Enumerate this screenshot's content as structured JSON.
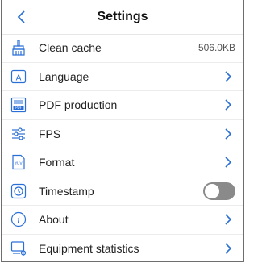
{
  "header": {
    "title": "Settings"
  },
  "colors": {
    "accent": "#2a6fd6",
    "toggle_off": "#8a8a8a"
  },
  "items": [
    {
      "name": "clean-cache",
      "label": "Clean cache",
      "value": "506.0KB",
      "icon": "broom-icon"
    },
    {
      "name": "language",
      "label": "Language",
      "icon": "language-icon"
    },
    {
      "name": "pdf-production",
      "label": "PDF production",
      "icon": "pdf-icon"
    },
    {
      "name": "fps",
      "label": "FPS",
      "icon": "sliders-icon"
    },
    {
      "name": "format",
      "label": "Format",
      "icon": "yuv-file-icon"
    },
    {
      "name": "timestamp",
      "label": "Timestamp",
      "toggle": "off",
      "icon": "timestamp-icon"
    },
    {
      "name": "about",
      "label": "About",
      "icon": "info-icon"
    },
    {
      "name": "equipment-statistics",
      "label": "Equipment statistics",
      "icon": "device-stats-icon"
    }
  ]
}
